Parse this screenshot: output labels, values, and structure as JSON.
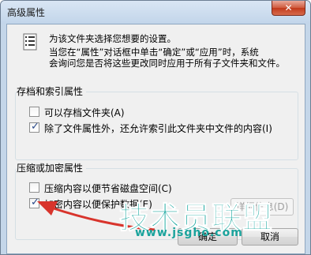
{
  "window": {
    "title": "高级属性",
    "close_glyph": "✕"
  },
  "info": {
    "line1": "为该文件夹选择您想要的设置。",
    "line2": "当您在“属性”对话框中单击“确定”或“应用”时，系统",
    "line3": "会询问您是否将这些更改同时应用于所有子文件夹和文件。"
  },
  "archive_group": {
    "title": "存档和索引属性",
    "items": [
      {
        "label": "可以存档文件夹(A)",
        "checked": false
      },
      {
        "label": "除了文件属性外，还允许索引此文件夹中文件的内容(I)",
        "checked": true
      }
    ]
  },
  "compress_group": {
    "title": "压缩或加密属性",
    "items": [
      {
        "label": "压缩内容以便节省磁盘空间(C)",
        "checked": false
      },
      {
        "label": "加密内容以便保护数据(E)",
        "checked": true
      }
    ],
    "details_label": "详细信息(D)"
  },
  "buttons": {
    "ok_label": "确定",
    "cancel_label": "取消"
  },
  "watermark": {
    "big": "技术员联盟",
    "small": "www.jsgho.com"
  },
  "colors": {
    "arrow": "#d8342c",
    "watermark": "#0da29a",
    "check": "#2a4a8a"
  },
  "check_glyph": "✓"
}
